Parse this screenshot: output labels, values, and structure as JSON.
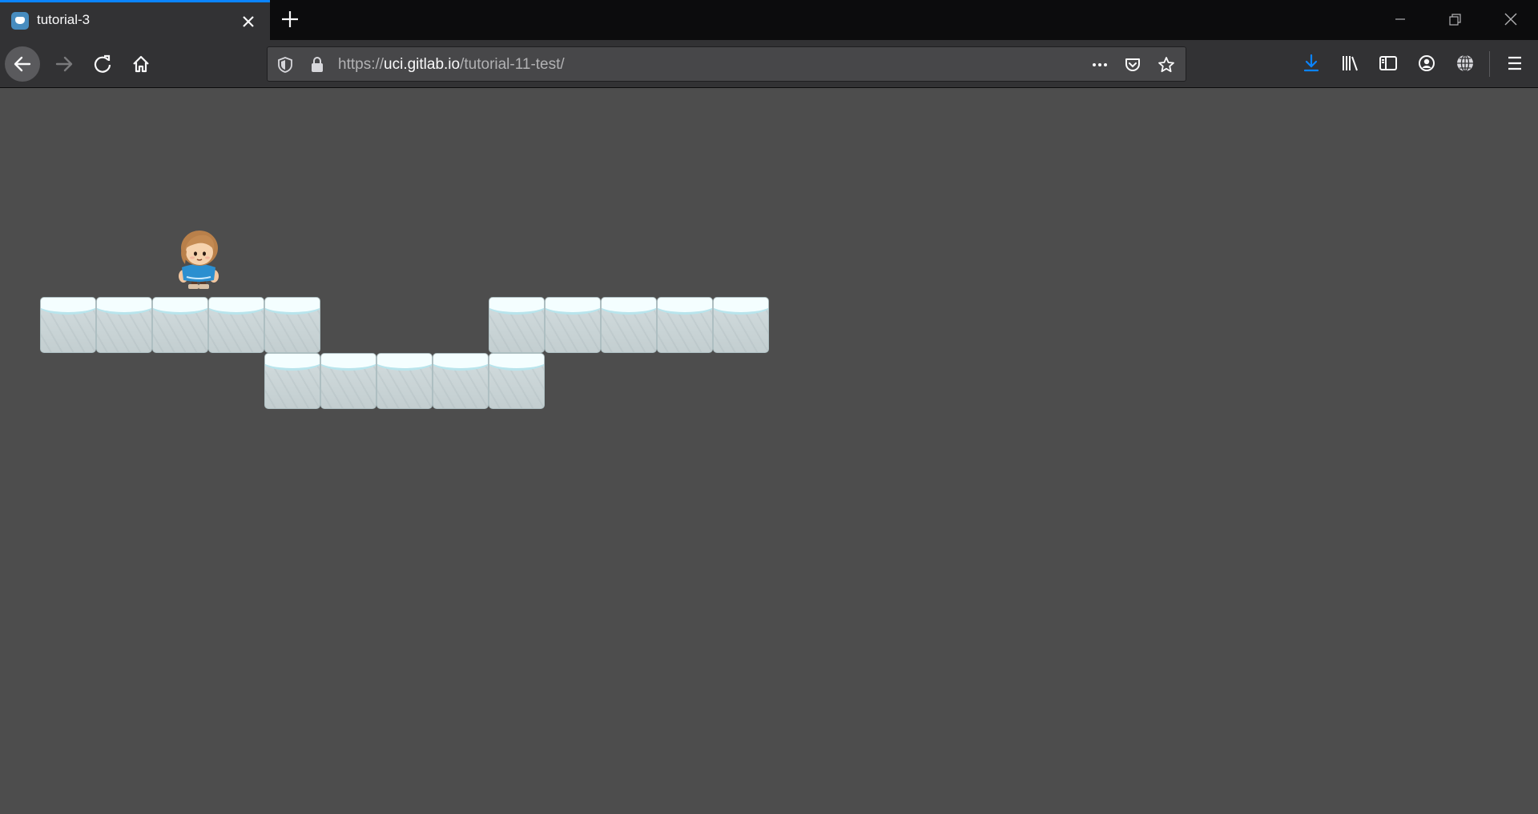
{
  "browser": {
    "tab": {
      "title": "tutorial-3"
    },
    "url": {
      "scheme": "https://",
      "host": "uci.gitlab.io",
      "path": "/tutorial-11-test/"
    },
    "icons": {
      "favicon": "godot-icon",
      "tab_close": "close-icon",
      "new_tab": "plus-icon",
      "minimize": "minimize-icon",
      "restore": "restore-icon",
      "close_window": "close-icon",
      "back": "arrow-left-icon",
      "forward": "arrow-right-icon",
      "reload": "reload-icon",
      "home": "home-icon",
      "tracking_protection": "shield-icon",
      "secure": "lock-icon",
      "page_actions": "more-icon",
      "pocket": "pocket-icon",
      "bookmark": "star-icon",
      "downloads": "download-icon",
      "library": "library-icon",
      "sidebar": "sidebar-icon",
      "account": "account-icon",
      "extension": "globe-icon",
      "menu": "hamburger-menu-icon"
    },
    "colors": {
      "accent": "#0a84ff",
      "chrome": "#323234",
      "tabstrip": "#0c0c0d"
    }
  },
  "game": {
    "background": "#4d4d4d",
    "tile_type": "snow-block",
    "tile_rows": [
      {
        "row": 0,
        "columns": [
          0,
          1,
          2,
          3,
          4,
          8,
          9,
          10,
          11,
          12
        ]
      },
      {
        "row": 1,
        "columns": [
          4,
          5,
          6,
          7,
          8
        ]
      }
    ],
    "player": {
      "character": "girl-in-blue-shirt",
      "standing_on_column": 3
    }
  }
}
